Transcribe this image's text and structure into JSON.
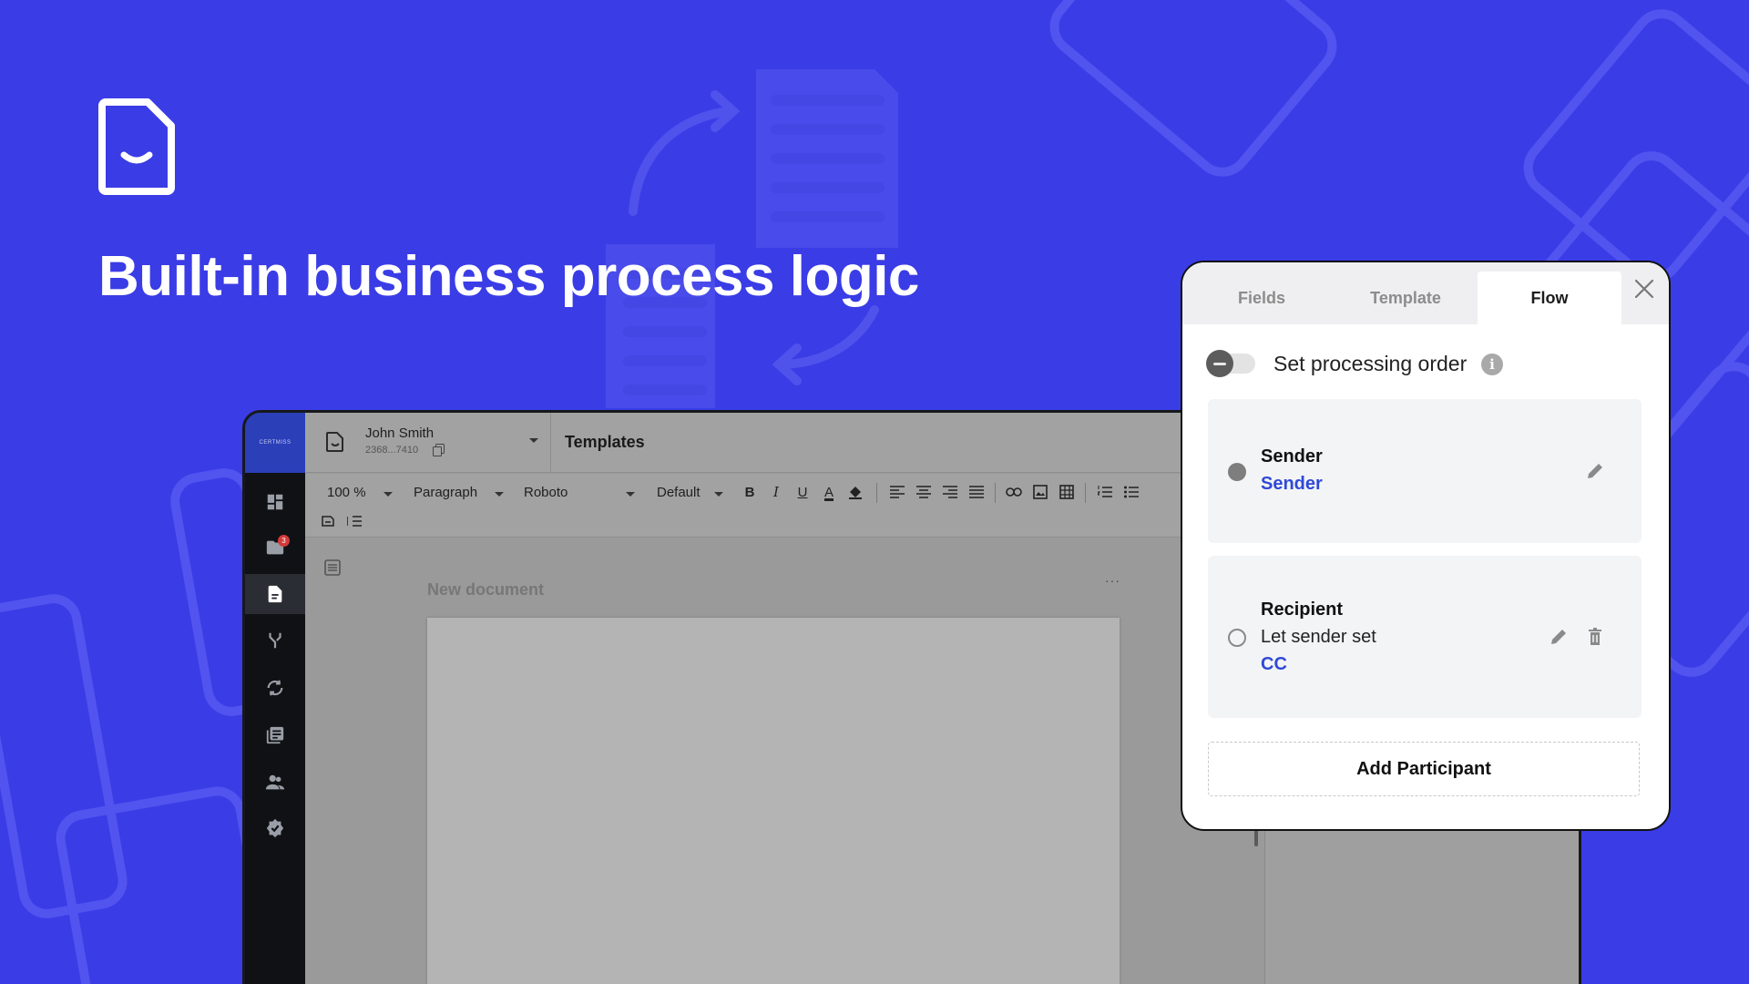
{
  "headline": "Built-in business process logic",
  "app": {
    "brand": "CERTMISS",
    "user": {
      "name": "John Smith",
      "id": "2368...7410"
    },
    "page_title": "Templates",
    "toolbar": {
      "zoom": "100 %",
      "style": "Paragraph",
      "font": "Roboto",
      "size": "Default",
      "bold": "B",
      "italic": "I",
      "underline": "U",
      "font_color": "A"
    },
    "document": {
      "name": "New document",
      "more": "···"
    },
    "sidebar": {
      "badge_count": "3"
    }
  },
  "panel": {
    "tabs": [
      {
        "label": "Fields"
      },
      {
        "label": "Template"
      },
      {
        "label": "Flow"
      }
    ],
    "active_tab": "Flow",
    "processing_order": {
      "label": "Set processing order",
      "enabled": false
    },
    "participants": [
      {
        "role": "Sender",
        "lines": [],
        "link": "Sender"
      },
      {
        "role": "Recipient",
        "lines": [
          "Let sender set"
        ],
        "link": "CC"
      }
    ],
    "add_participant_label": "Add Participant"
  },
  "colors": {
    "background": "#3a3ce6",
    "accent_link": "#2f49d6",
    "app_sidebar": "#0f1114"
  }
}
